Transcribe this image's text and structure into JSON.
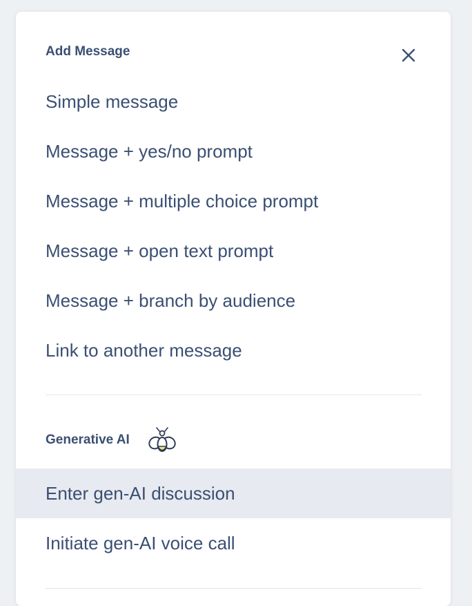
{
  "dialog": {
    "title": "Add Message",
    "close_icon": "close-icon"
  },
  "message_types": [
    {
      "label": "Simple message"
    },
    {
      "label": "Message + yes/no prompt"
    },
    {
      "label": "Message + multiple choice prompt"
    },
    {
      "label": "Message + open text prompt"
    },
    {
      "label": "Message + branch by audience"
    },
    {
      "label": "Link to another message"
    }
  ],
  "generative_ai": {
    "title": "Generative AI",
    "icon": "bee-icon",
    "items": [
      {
        "label": "Enter gen-AI discussion",
        "highlighted": true
      },
      {
        "label": "Initiate gen-AI voice call",
        "highlighted": false
      }
    ]
  },
  "colors": {
    "text": "#3a4f73",
    "highlight": "#e7eaf0",
    "bee_accent": "#e8ea7a",
    "background": "#eef1f4"
  }
}
